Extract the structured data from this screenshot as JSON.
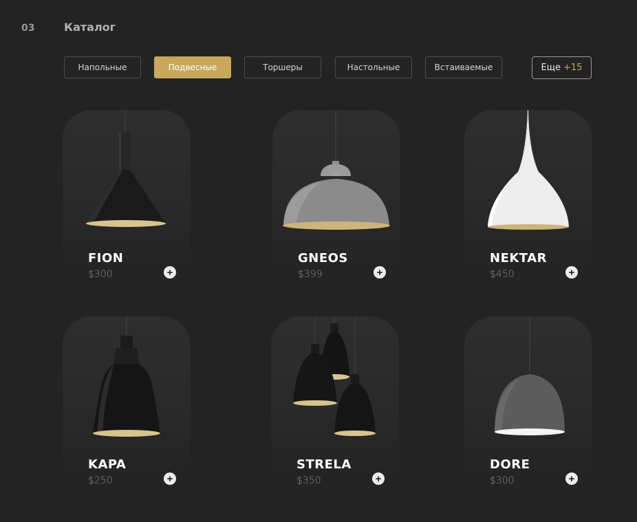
{
  "section": {
    "number": "03",
    "title": "Каталог"
  },
  "filters": [
    {
      "label": "Напольные",
      "active": false
    },
    {
      "label": "Подвесные",
      "active": true
    },
    {
      "label": "Торшеры",
      "active": false
    },
    {
      "label": "Настольные",
      "active": false
    },
    {
      "label": "Встаиваемые",
      "active": false
    }
  ],
  "more": {
    "label": "Еще",
    "count": "+15"
  },
  "products": [
    {
      "name": "FION",
      "price": "$300",
      "icon": "plus-icon"
    },
    {
      "name": "GNEOS",
      "price": "$399",
      "icon": "plus-icon"
    },
    {
      "name": "NEKTAR",
      "price": "$450",
      "icon": "plus-icon"
    },
    {
      "name": "KAPA",
      "price": "$250",
      "icon": "plus-icon"
    },
    {
      "name": "STRELA",
      "price": "$350",
      "icon": "plus-icon"
    },
    {
      "name": "DORE",
      "price": "$300",
      "icon": "plus-icon"
    }
  ],
  "colors": {
    "background": "#232323",
    "accent": "#c8a85c",
    "card": "#2c2c2c"
  }
}
